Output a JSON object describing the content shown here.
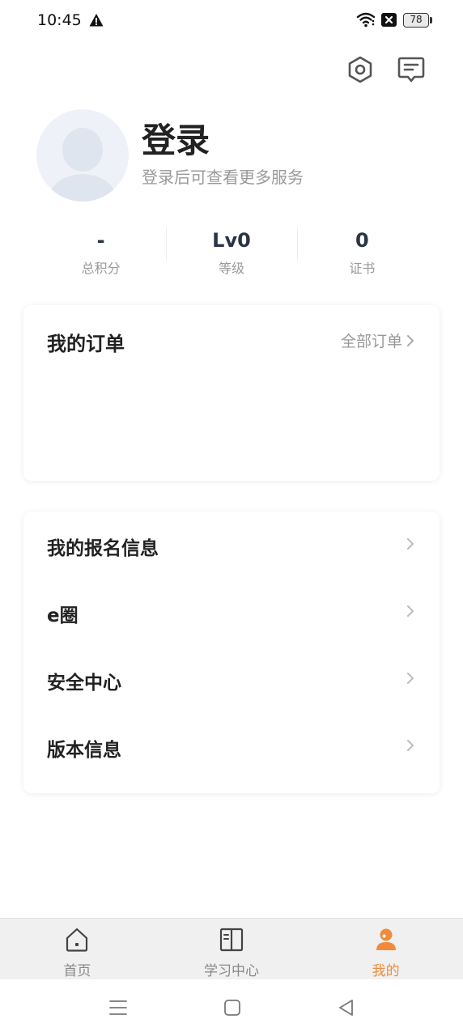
{
  "status_bar": {
    "time": "10:45",
    "battery": "78"
  },
  "profile": {
    "title": "登录",
    "subtitle": "登录后可查看更多服务"
  },
  "stats": [
    {
      "value": "-",
      "label": "总积分"
    },
    {
      "value": "Lv0",
      "label": "等级"
    },
    {
      "value": "0",
      "label": "证书"
    }
  ],
  "orders": {
    "title": "我的订单",
    "all_label": "全部订单"
  },
  "menu": [
    {
      "label": "我的报名信息"
    },
    {
      "label": "e圈"
    },
    {
      "label": "安全中心"
    },
    {
      "label": "版本信息"
    }
  ],
  "bottom_nav": [
    {
      "label": "首页",
      "icon": "home-icon"
    },
    {
      "label": "学习中心",
      "icon": "book-icon"
    },
    {
      "label": "我的",
      "icon": "user-icon",
      "active": true
    }
  ],
  "colors": {
    "accent": "#f08a3c",
    "stat_value": "#2b3447",
    "muted": "#999999"
  }
}
